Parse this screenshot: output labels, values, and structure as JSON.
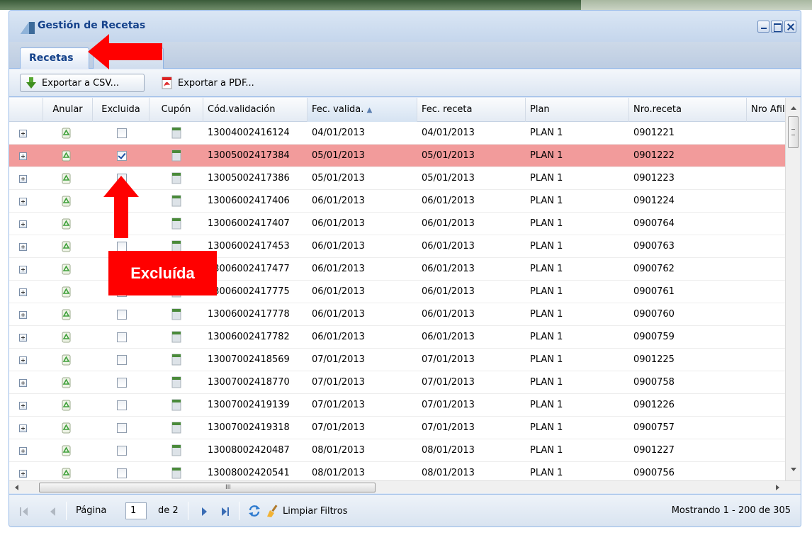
{
  "window": {
    "title": "Gestión de Recetas"
  },
  "tabs": [
    {
      "label": "Recetas",
      "active": true
    },
    {
      "label": "",
      "active": false
    }
  ],
  "toolbar": {
    "csv_label": "Exportar a CSV...",
    "pdf_label": "Exportar a PDF..."
  },
  "grid": {
    "columns": [
      {
        "key": "expand",
        "label": ""
      },
      {
        "key": "anular",
        "label": "Anular"
      },
      {
        "key": "excluida",
        "label": "Excluida"
      },
      {
        "key": "cupon",
        "label": "Cupón"
      },
      {
        "key": "cod",
        "label": "Cód.validación"
      },
      {
        "key": "fecval",
        "label": "Fec. valida."
      },
      {
        "key": "fecrec",
        "label": "Fec. receta"
      },
      {
        "key": "plan",
        "label": "Plan"
      },
      {
        "key": "nro",
        "label": "Nro.receta"
      },
      {
        "key": "afil",
        "label": "Nro Afiliac"
      }
    ],
    "sorted_column": "fecval",
    "sort_direction": "asc",
    "rows": [
      {
        "cod": "13004002416124",
        "fecval": "04/01/2013",
        "fecrec": "04/01/2013",
        "plan": "PLAN 1",
        "nro": "0901221",
        "excluida": false,
        "selected": false
      },
      {
        "cod": "13005002417384",
        "fecval": "05/01/2013",
        "fecrec": "05/01/2013",
        "plan": "PLAN 1",
        "nro": "0901222",
        "excluida": true,
        "selected": true
      },
      {
        "cod": "13005002417386",
        "fecval": "05/01/2013",
        "fecrec": "05/01/2013",
        "plan": "PLAN 1",
        "nro": "0901223",
        "excluida": false,
        "selected": false
      },
      {
        "cod": "13006002417406",
        "fecval": "06/01/2013",
        "fecrec": "06/01/2013",
        "plan": "PLAN 1",
        "nro": "0901224",
        "excluida": false,
        "selected": false
      },
      {
        "cod": "13006002417407",
        "fecval": "06/01/2013",
        "fecrec": "06/01/2013",
        "plan": "PLAN 1",
        "nro": "0900764",
        "excluida": false,
        "selected": false
      },
      {
        "cod": "13006002417453",
        "fecval": "06/01/2013",
        "fecrec": "06/01/2013",
        "plan": "PLAN 1",
        "nro": "0900763",
        "excluida": false,
        "selected": false
      },
      {
        "cod": "13006002417477",
        "fecval": "06/01/2013",
        "fecrec": "06/01/2013",
        "plan": "PLAN 1",
        "nro": "0900762",
        "excluida": false,
        "selected": false
      },
      {
        "cod": "13006002417775",
        "fecval": "06/01/2013",
        "fecrec": "06/01/2013",
        "plan": "PLAN 1",
        "nro": "0900761",
        "excluida": false,
        "selected": false
      },
      {
        "cod": "13006002417778",
        "fecval": "06/01/2013",
        "fecrec": "06/01/2013",
        "plan": "PLAN 1",
        "nro": "0900760",
        "excluida": false,
        "selected": false
      },
      {
        "cod": "13006002417782",
        "fecval": "06/01/2013",
        "fecrec": "06/01/2013",
        "plan": "PLAN 1",
        "nro": "0900759",
        "excluida": false,
        "selected": false
      },
      {
        "cod": "13007002418569",
        "fecval": "07/01/2013",
        "fecrec": "07/01/2013",
        "plan": "PLAN 1",
        "nro": "0901225",
        "excluida": false,
        "selected": false
      },
      {
        "cod": "13007002418770",
        "fecval": "07/01/2013",
        "fecrec": "07/01/2013",
        "plan": "PLAN 1",
        "nro": "0900758",
        "excluida": false,
        "selected": false
      },
      {
        "cod": "13007002419139",
        "fecval": "07/01/2013",
        "fecrec": "07/01/2013",
        "plan": "PLAN 1",
        "nro": "0901226",
        "excluida": false,
        "selected": false
      },
      {
        "cod": "13007002419318",
        "fecval": "07/01/2013",
        "fecrec": "07/01/2013",
        "plan": "PLAN 1",
        "nro": "0900757",
        "excluida": false,
        "selected": false
      },
      {
        "cod": "13008002420487",
        "fecval": "08/01/2013",
        "fecrec": "08/01/2013",
        "plan": "PLAN 1",
        "nro": "0901227",
        "excluida": false,
        "selected": false
      },
      {
        "cod": "13008002420541",
        "fecval": "08/01/2013",
        "fecrec": "08/01/2013",
        "plan": "PLAN 1",
        "nro": "0900756",
        "excluida": false,
        "selected": false
      }
    ]
  },
  "pager": {
    "page_label": "Página",
    "page_value": "1",
    "of_label": "de 2",
    "clear_filters_label": "Limpiar Filtros",
    "status": "Mostrando 1 - 200 de 305"
  },
  "annotation": {
    "callout_text": "Excluída",
    "color": "#ff0000"
  },
  "colors": {
    "selected_row": "#f29b9b",
    "header_text": "#15428b"
  }
}
